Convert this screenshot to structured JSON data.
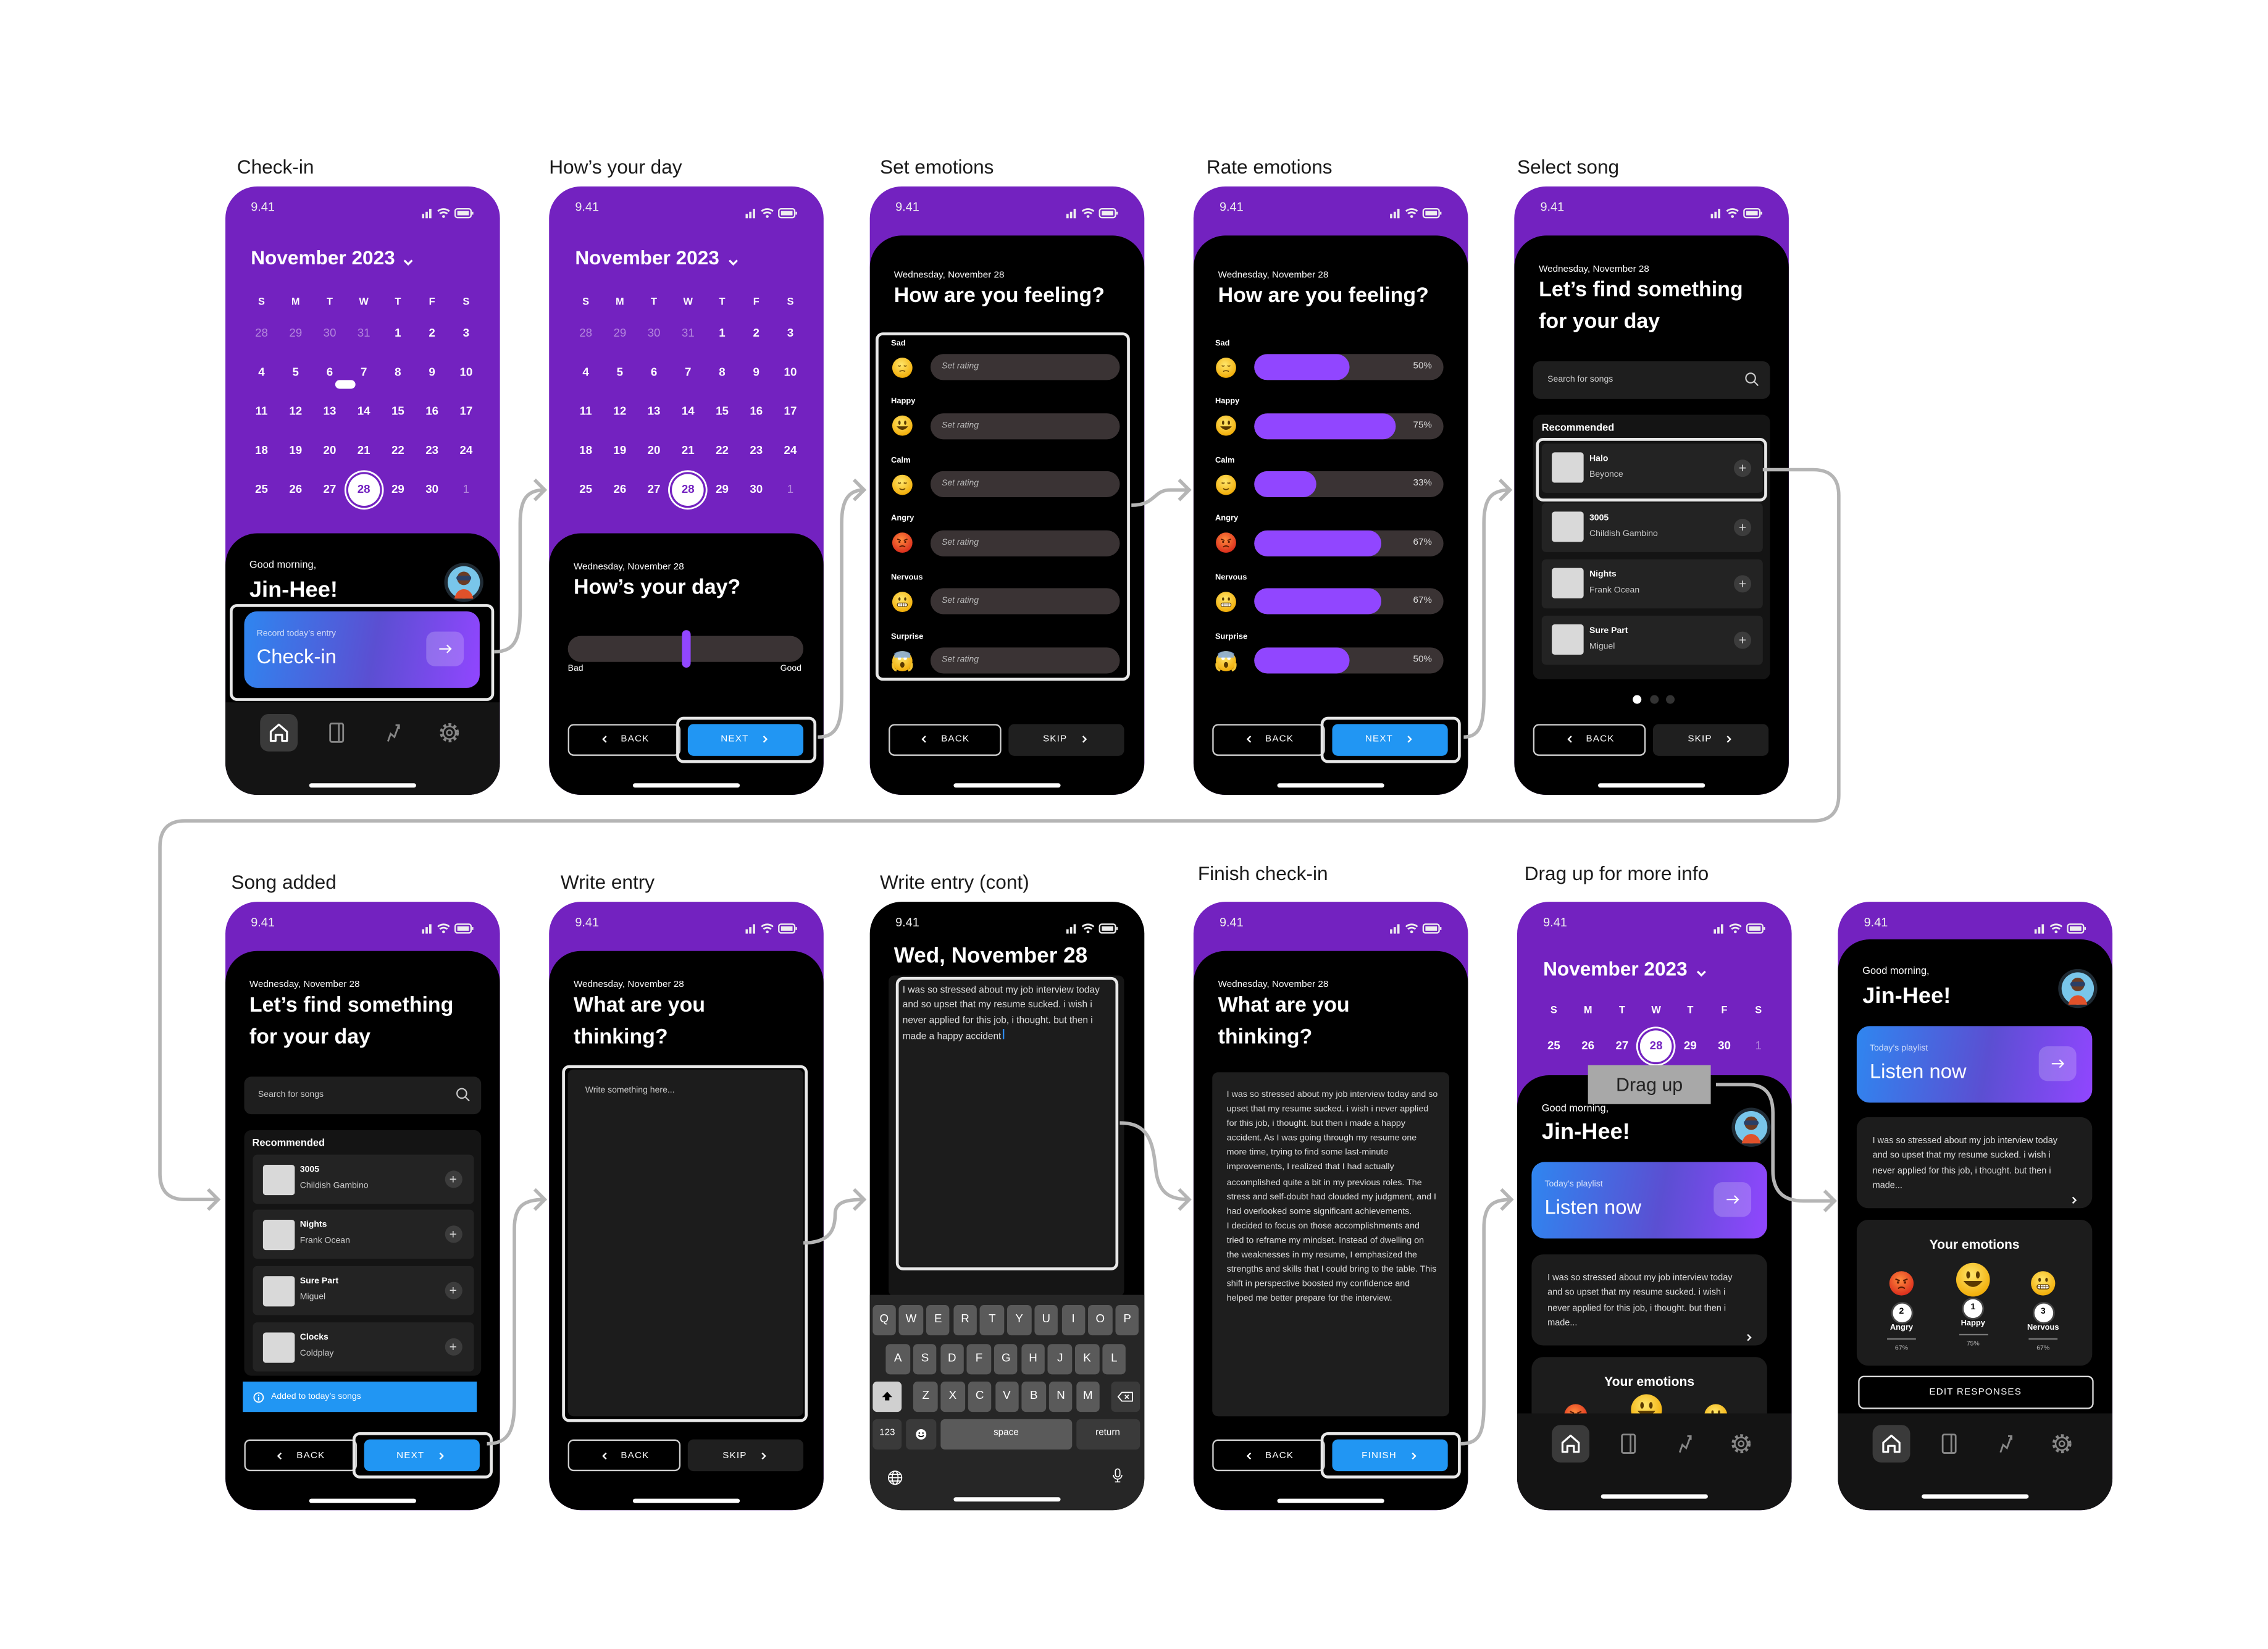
{
  "colors": {
    "purple": "#7322C0",
    "accent": "#9146FF",
    "blue": "#2196F3",
    "background": "#000000",
    "connector": "#b5b5b5"
  },
  "flow": {
    "check_in": "Check-in",
    "hows_your_day": "How’s your day",
    "set_emotions": "Set emotions",
    "rate_emotions": "Rate  emotions",
    "select_song": "Select song",
    "song_added": "Song added",
    "write_entry": "Write entry",
    "write_entry_cont": "Write entry (cont)",
    "finish_checkin": "Finish check-in",
    "drag_up": "Drag up for more info"
  },
  "common": {
    "time": "9.41",
    "date": "Wednesday,  November 28",
    "back": "BACK",
    "next": "NEXT",
    "skip": "SKIP",
    "finish": "FINISH",
    "greeting": "Good morning,",
    "name": "Jin-Hee!"
  },
  "calendar": {
    "month": "November 2023",
    "weekdays": [
      "S",
      "M",
      "T",
      "W",
      "T",
      "F",
      "S"
    ],
    "weeks": [
      [
        "28",
        "29",
        "30",
        "31",
        "1",
        "2",
        "3"
      ],
      [
        "4",
        "5",
        "6",
        "7",
        "8",
        "9",
        "10"
      ],
      [
        "11",
        "12",
        "13",
        "14",
        "15",
        "16",
        "17"
      ],
      [
        "18",
        "19",
        "20",
        "21",
        "22",
        "23",
        "24"
      ],
      [
        "25",
        "26",
        "27",
        "28",
        "29",
        "30",
        "1"
      ]
    ],
    "selected": "28"
  },
  "checkin": {
    "caption": "Record today’s entry",
    "title": "Check-in"
  },
  "day": {
    "title": "How’s your day?",
    "low": "Bad",
    "high": "Good",
    "rating": 0.5
  },
  "emotions": {
    "title": "How are you feeling?",
    "placeholder": "Set rating",
    "items": [
      {
        "label": "Sad",
        "emoji": "pensive-face",
        "rating": 50,
        "rating_label": "50%"
      },
      {
        "label": "Happy",
        "emoji": "smiling-face",
        "rating": 75,
        "rating_label": "75%"
      },
      {
        "label": "Calm",
        "emoji": "relieved-face",
        "rating": 33,
        "rating_label": "33%"
      },
      {
        "label": "Angry",
        "emoji": "angry-face",
        "rating": 67,
        "rating_label": "67%"
      },
      {
        "label": "Nervous",
        "emoji": "grimacing-face",
        "rating": 67,
        "rating_label": "67%"
      },
      {
        "label": "Surprise",
        "emoji": "screaming-face",
        "rating": 50,
        "rating_label": "50%"
      }
    ]
  },
  "songs": {
    "title_line1": "Let’s find something",
    "title_line2": "for your day",
    "search_placeholder": "Search for songs",
    "recommended": "Recommended",
    "recommended_list": [
      {
        "title": "Halo",
        "artist": "Beyonce"
      },
      {
        "title": "3005",
        "artist": "Childish Gambino"
      },
      {
        "title": "Nights",
        "artist": "Frank Ocean"
      },
      {
        "title": "Sure Part",
        "artist": "Miguel"
      }
    ],
    "after_add_list": [
      {
        "title": "3005",
        "artist": "Childish Gambino"
      },
      {
        "title": "Nights",
        "artist": "Frank Ocean"
      },
      {
        "title": "Sure Part",
        "artist": "Miguel"
      },
      {
        "title": "Clocks",
        "artist": "Coldplay"
      }
    ],
    "added_toast": "Added to today’s songs",
    "pages": 3,
    "active_page": 1
  },
  "entry": {
    "title_line1": "What are you",
    "title_line2": "thinking?",
    "placeholder": "Write something here...",
    "short_date": "Wed, November 28",
    "draft": "I was so stressed about my job interview today and so upset that my resume sucked. i wish i never applied for this job, i thought. but then i made a happy accident",
    "full_p1": "I was so stressed about my job interview today and so upset that my resume sucked. i wish i never applied for this job, i thought. but then i made a happy accident.  As I was going through my resume one more time, trying to find some last-minute improvements, I realized that I had actually accomplished quite a bit in my previous roles. The stress and self-doubt had clouded my judgment, and I had overlooked some significant achievements.",
    "full_p2": "I decided to focus on those accomplishments and tried to reframe my mindset. Instead of dwelling on the weaknesses in my resume, I emphasized the strengths and skills that I could bring to the table. This shift in perspective boosted my confidence and helped me better prepare for the interview."
  },
  "keyboard": {
    "rows": [
      [
        "Q",
        "W",
        "E",
        "R",
        "T",
        "Y",
        "U",
        "I",
        "O",
        "P"
      ],
      [
        "A",
        "S",
        "D",
        "F",
        "G",
        "H",
        "J",
        "K",
        "L"
      ],
      [
        "Z",
        "X",
        "C",
        "V",
        "B",
        "N",
        "M"
      ]
    ],
    "numbers": "123",
    "space": "space",
    "return": "return"
  },
  "home": {
    "playlist_caption": "Today’s playlist",
    "playlist_title": "Listen now",
    "journal_preview": "I was so stressed about my job interview  today and so upset that my resume sucked. i wish i never applied for this job, i thought. but then i made...",
    "emotions_title": "Your emotions",
    "top_emotions": [
      {
        "rank": "2",
        "label": "Angry",
        "percent": "67%",
        "emoji": "angry-face"
      },
      {
        "rank": "1",
        "label": "Happy",
        "percent": "75%",
        "emoji": "smiling-face"
      },
      {
        "rank": "3",
        "label": "Nervous",
        "percent": "67%",
        "emoji": "grimacing-face"
      }
    ],
    "edit": "EDIT RESPONSES",
    "drag_hint": "Drag up"
  },
  "nav": {
    "items": [
      "home-icon",
      "journal-icon",
      "trend-icon",
      "settings-icon"
    ],
    "active": 0
  }
}
